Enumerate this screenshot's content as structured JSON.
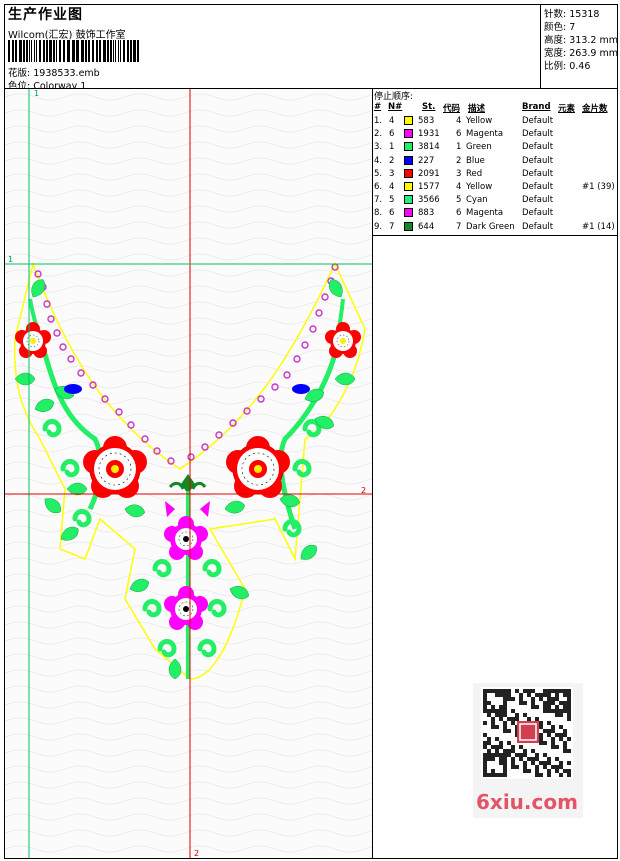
{
  "header": {
    "title": "生产作业图",
    "company": "Wilcom(汇宏) 鼓饰工作室",
    "design_label": "花版:",
    "design_file": "1938533.emb",
    "colorway_label": "色位:",
    "colorway": "Colorway 1"
  },
  "stats": {
    "stitches_label": "针数:",
    "stitches": "15318",
    "colors_label": "颜色:",
    "colors": "7",
    "height_label": "高度:",
    "height": "313.2 mm",
    "width_label": "宽度:",
    "width": "263.9 mm",
    "scale_label": "比例:",
    "scale": "0.46"
  },
  "stop_table": {
    "caption": "停止顺序:",
    "headers": [
      "#",
      "N#",
      "St.",
      "代码",
      "描述",
      "Brand",
      "元素",
      "金片数"
    ],
    "rows": [
      {
        "idx": "1.",
        "n": "4",
        "color": "#ffff00",
        "st": "583",
        "code": "4",
        "desc": "Yellow",
        "brand": "Default",
        "elem": "",
        "seq": ""
      },
      {
        "idx": "2.",
        "n": "6",
        "color": "#ff00ff",
        "st": "1931",
        "code": "6",
        "desc": "Magenta",
        "brand": "Default",
        "elem": "",
        "seq": ""
      },
      {
        "idx": "3.",
        "n": "1",
        "color": "#22ee66",
        "st": "3814",
        "code": "1",
        "desc": "Green",
        "brand": "Default",
        "elem": "",
        "seq": ""
      },
      {
        "idx": "4.",
        "n": "2",
        "color": "#0000ff",
        "st": "227",
        "code": "2",
        "desc": "Blue",
        "brand": "Default",
        "elem": "",
        "seq": ""
      },
      {
        "idx": "5.",
        "n": "3",
        "color": "#ff0000",
        "st": "2091",
        "code": "3",
        "desc": "Red",
        "brand": "Default",
        "elem": "",
        "seq": ""
      },
      {
        "idx": "6.",
        "n": "4",
        "color": "#ffff00",
        "st": "1577",
        "code": "4",
        "desc": "Yellow",
        "brand": "Default",
        "elem": "",
        "seq": "#1 (39)"
      },
      {
        "idx": "7.",
        "n": "5",
        "color": "#22ee88",
        "st": "3566",
        "code": "5",
        "desc": "Cyan",
        "brand": "Default",
        "elem": "",
        "seq": ""
      },
      {
        "idx": "8.",
        "n": "6",
        "color": "#ff00ff",
        "st": "883",
        "code": "6",
        "desc": "Magenta",
        "brand": "Default",
        "elem": "",
        "seq": ""
      },
      {
        "idx": "9.",
        "n": "7",
        "color": "#118822",
        "st": "644",
        "code": "7",
        "desc": "Dark Green",
        "brand": "Default",
        "elem": "",
        "seq": "#1 (14)"
      }
    ]
  },
  "guides": {
    "v1_label_top": "1",
    "h1_label": "1",
    "h2_label": "2",
    "v2_label_bottom": "2"
  },
  "watermark": {
    "logo_text": "6xiu.com"
  },
  "colors": {
    "guide_red": "#e00000",
    "guide_green": "#00c060",
    "green": "#22ee66",
    "dark_green": "#118822",
    "red": "#ff0000",
    "yellow": "#ffff00",
    "magenta": "#ff00ff",
    "blue": "#0000ff",
    "purple": "#cc33cc"
  }
}
